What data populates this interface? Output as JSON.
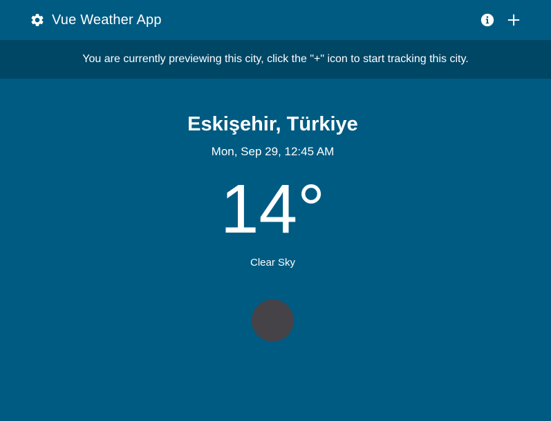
{
  "header": {
    "title": "Vue Weather App",
    "logo_icon": "gear-icon",
    "info_icon": "info-icon",
    "add_icon": "plus-icon"
  },
  "banner": {
    "text": "You are currently previewing this city, click the \"+\" icon to start tracking this city."
  },
  "weather": {
    "city": "Eskişehir, Türkiye",
    "datetime": "Mon, Sep 29, 12:45 AM",
    "temperature": "14°",
    "condition": "Clear Sky",
    "icon": "clear-sky-icon"
  },
  "colors": {
    "background": "#005b82",
    "banner": "#004766",
    "icon_placeholder": "#454348",
    "text": "#ffffff"
  }
}
